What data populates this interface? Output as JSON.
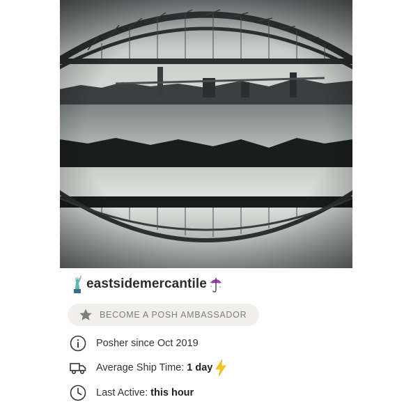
{
  "closet": {
    "username": "eastsidemercantile",
    "cover_image": "black-and-white photo of an arch bridge over a river reflected in the water",
    "leading_emoji": "statue-of-liberty-emoji",
    "trailing_emoji": "umbrella-emoji"
  },
  "ambassador_button": {
    "label": "BECOME A POSH AMBASSADOR",
    "icon": "star-icon"
  },
  "stats": {
    "posher_since": {
      "icon": "info-icon",
      "label": "Posher since Oct 2019"
    },
    "ship_time": {
      "icon": "truck-icon",
      "label": "Average Ship Time:",
      "value": "1 day",
      "badge_icon": "lightning-bolt-emoji"
    },
    "last_active": {
      "icon": "clock-icon",
      "label": "Last Active:",
      "value": "this hour"
    }
  },
  "colors": {
    "pill_bg": "#f1efec",
    "muted_text": "#7e7e7e",
    "emoji_umbrella": "#9b3fb5",
    "emoji_bolt": "#f5c518"
  }
}
